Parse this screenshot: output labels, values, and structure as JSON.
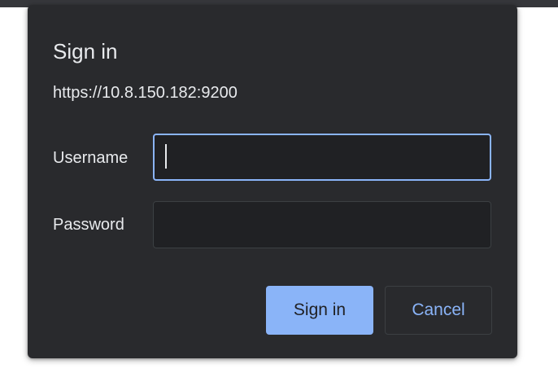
{
  "dialog": {
    "title": "Sign in",
    "url": "https://10.8.150.182:9200",
    "username": {
      "label": "Username",
      "value": "",
      "placeholder": ""
    },
    "password": {
      "label": "Password",
      "value": "",
      "placeholder": ""
    },
    "buttons": {
      "sign_in": "Sign in",
      "cancel": "Cancel"
    }
  },
  "colors": {
    "dialog_background": "#292a2d",
    "input_background": "#202124",
    "accent": "#8ab4f8",
    "text": "#e8eaed",
    "border": "#3c4043"
  }
}
